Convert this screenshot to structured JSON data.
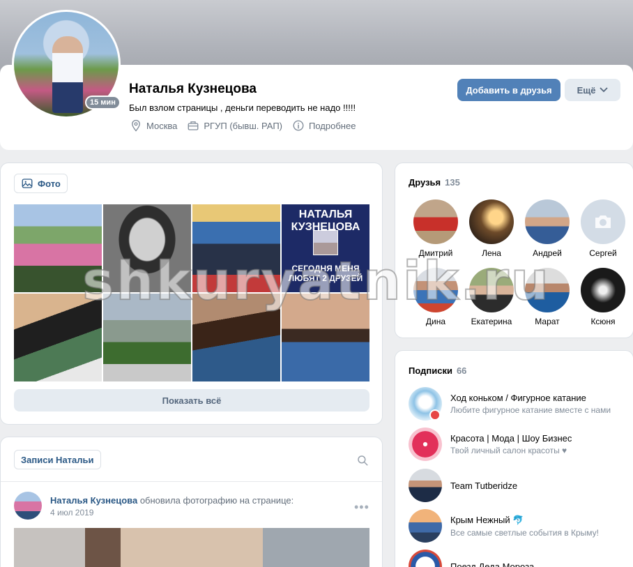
{
  "profile": {
    "name": "Наталья Кузнецова",
    "status": "Был взлом страницы , деньги переводить не надо !!!!!",
    "online": "15 мин",
    "city": "Москва",
    "university": "РГУП (бывш. РАП)",
    "details": "Подробнее",
    "add_friend_label": "Добавить в друзья",
    "more_label": "Ещё"
  },
  "photos": {
    "tab_label": "Фото",
    "tile4_text": "НАТАЛЬЯ КУЗНЕЦОВА",
    "tile4_sub": "СЕГОДНЯ МЕНЯ ЛЮБЯТ 2 ДРУЗЕЙ",
    "show_all_label": "Показать всё"
  },
  "wall": {
    "tab_label": "Записи Натальи",
    "post": {
      "author": "Наталья Кузнецова",
      "action": "обновила фотографию на странице:",
      "date": "4 июл 2019"
    }
  },
  "friends": {
    "title": "Друзья",
    "count": "135",
    "items": [
      {
        "name": "Дмитрий"
      },
      {
        "name": "Лена"
      },
      {
        "name": "Андрей"
      },
      {
        "name": "Сергей"
      },
      {
        "name": "Дина"
      },
      {
        "name": "Екатерина"
      },
      {
        "name": "Марат"
      },
      {
        "name": "Ксюня"
      }
    ]
  },
  "subscriptions": {
    "title": "Подписки",
    "count": "66",
    "items": [
      {
        "name": "Ход коньком / Фигурное катание",
        "desc": "Любите фигурное катание вместе с нами"
      },
      {
        "name": "Красота | Мода | Шоу Бизнес",
        "desc": "Твой личный салон красоты ♥"
      },
      {
        "name": "Team Tutberidze",
        "desc": ""
      },
      {
        "name": "Крым Нежный 🐬",
        "desc": "Все самые светлые события в Крыму!"
      },
      {
        "name": "Поезд Деда Мороза",
        "desc": ""
      }
    ]
  },
  "watermark": "shkuryatnik.ru"
}
